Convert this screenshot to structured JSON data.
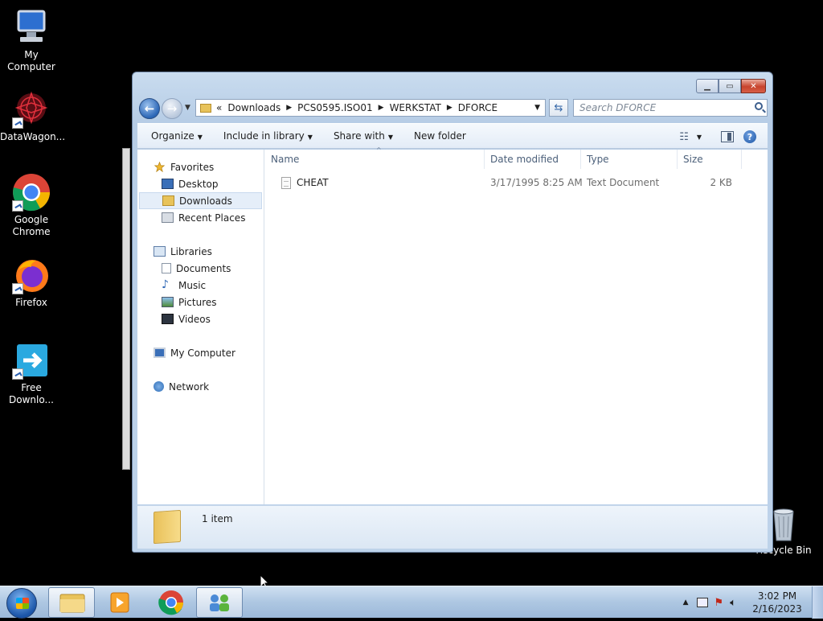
{
  "desktop": {
    "icons": [
      {
        "label": "My Computer"
      },
      {
        "label": "DataWagon..."
      },
      {
        "label": "Google Chrome"
      },
      {
        "label": "Firefox"
      },
      {
        "label": "Free Downlo..."
      },
      {
        "label": "Recycle Bin"
      }
    ]
  },
  "window": {
    "address": {
      "overflow": "«",
      "crumbs": [
        "Downloads",
        "PCS0595.ISO01",
        "WERKSTAT",
        "DFORCE"
      ]
    },
    "search_placeholder": "Search DFORCE",
    "toolbar": {
      "organize": "Organize",
      "include_in_library": "Include in library",
      "share_with": "Share with",
      "new_folder": "New folder"
    },
    "nav": {
      "favorites": "Favorites",
      "desktop": "Desktop",
      "downloads": "Downloads",
      "recent_places": "Recent Places",
      "libraries": "Libraries",
      "documents": "Documents",
      "music": "Music",
      "pictures": "Pictures",
      "videos": "Videos",
      "my_computer": "My Computer",
      "network": "Network"
    },
    "columns": {
      "name": "Name",
      "date_modified": "Date modified",
      "type": "Type",
      "size": "Size"
    },
    "files": [
      {
        "name": "CHEAT",
        "date_modified": "3/17/1995 8:25 AM",
        "type": "Text Document",
        "size": "2 KB"
      }
    ],
    "status": "1 item"
  },
  "taskbar": {
    "time": "3:02 PM",
    "date": "2/16/2023"
  },
  "colors": {
    "selection": "#e5eef9",
    "accent": "#2b66b6"
  }
}
